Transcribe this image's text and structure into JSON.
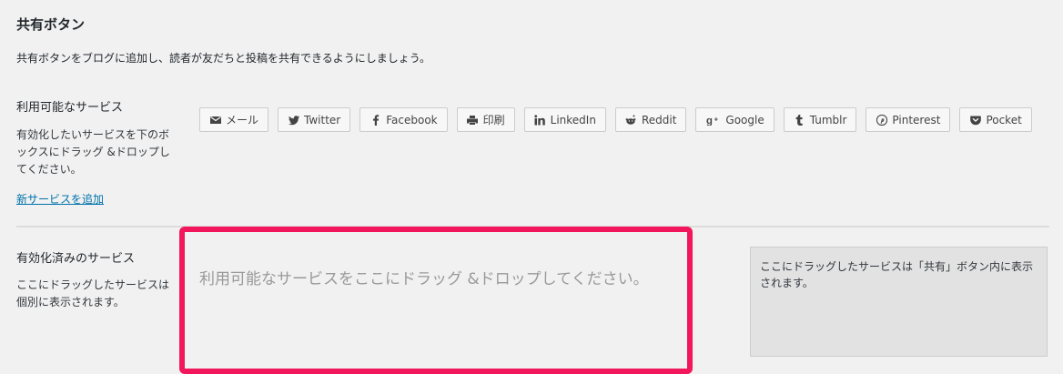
{
  "title": "共有ボタン",
  "description": "共有ボタンをブログに追加し、読者が友だちと投稿を共有できるようにしましょう。",
  "available": {
    "heading": "利用可能なサービス",
    "help": "有効化したいサービスを下のボックスにドラッグ &ドロップしてください。",
    "add_link": "新サービスを追加",
    "services": [
      {
        "label": "メール",
        "icon": "mail-icon"
      },
      {
        "label": "Twitter",
        "icon": "twitter-icon"
      },
      {
        "label": "Facebook",
        "icon": "facebook-icon"
      },
      {
        "label": "印刷",
        "icon": "print-icon"
      },
      {
        "label": "LinkedIn",
        "icon": "linkedin-icon"
      },
      {
        "label": "Reddit",
        "icon": "reddit-icon"
      },
      {
        "label": "Google",
        "icon": "google-plus-icon"
      },
      {
        "label": "Tumblr",
        "icon": "tumblr-icon"
      },
      {
        "label": "Pinterest",
        "icon": "pinterest-icon"
      },
      {
        "label": "Pocket",
        "icon": "pocket-icon"
      }
    ]
  },
  "enabled": {
    "heading": "有効化済みのサービス",
    "help": "ここにドラッグしたサービスは個別に表示されます。",
    "dropzone_placeholder": "利用可能なサービスをここにドラッグ &ドロップしてください。",
    "preview_text": "ここにドラッグしたサービスは「共有」ボタン内に表示されます。"
  },
  "colors": {
    "highlight_border": "#f2165c",
    "link": "#0073aa"
  }
}
